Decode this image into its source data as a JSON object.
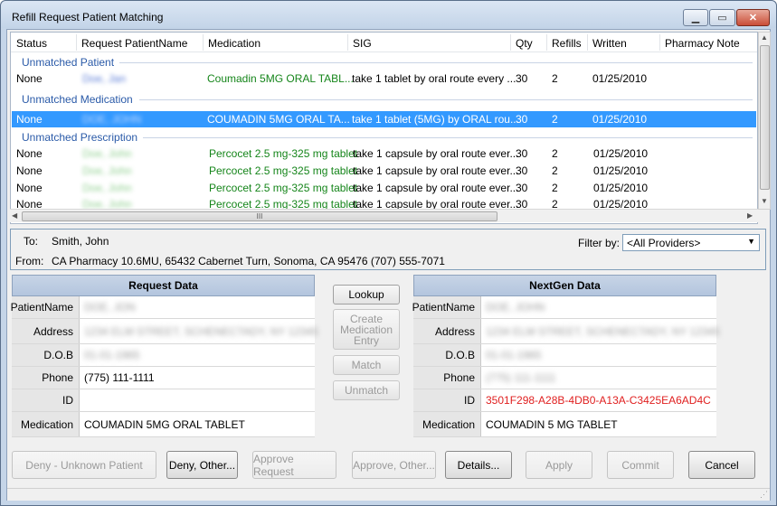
{
  "window": {
    "title": "Refill Request Patient Matching"
  },
  "list": {
    "columns": [
      "Status",
      "Request PatientName",
      "Medication",
      "SIG",
      "Qty",
      "Refills",
      "Written",
      "Pharmacy Note"
    ],
    "groups": [
      {
        "label": "Unmatched Patient"
      },
      {
        "label": "Unmatched Medication"
      },
      {
        "label": "Unmatched Prescription"
      }
    ],
    "rows": [
      {
        "status": "None",
        "name": "Doe, Jan",
        "medication": "Coumadin 5MG ORAL TABL...",
        "sig": "take 1 tablet by oral route  every ...",
        "qty": "30",
        "refills": "2",
        "written": "01/25/2010"
      },
      {
        "status": "None",
        "name": "DOE, JOHN",
        "medication": "COUMADIN 5MG ORAL TA...",
        "sig": "take 1 tablet (5MG)  by ORAL rou...",
        "qty": "30",
        "refills": "2",
        "written": "01/25/2010"
      },
      {
        "status": "None",
        "name": "Doe, John",
        "medication": "Percocet 2.5 mg-325 mg tablet",
        "sig": "take 1 capsule by oral route  ever...",
        "qty": "30",
        "refills": "2",
        "written": "01/25/2010"
      },
      {
        "status": "None",
        "name": "Doe, John",
        "medication": "Percocet 2.5 mg-325 mg tablet",
        "sig": "take 1 capsule by oral route  ever...",
        "qty": "30",
        "refills": "2",
        "written": "01/25/2010"
      },
      {
        "status": "None",
        "name": "Doe, John",
        "medication": "Percocet 2.5 mg-325 mg tablet",
        "sig": "take 1 capsule by oral route  ever...",
        "qty": "30",
        "refills": "2",
        "written": "01/25/2010"
      },
      {
        "status": "None",
        "name": "Doe, John",
        "medication": "Percocet 2.5 mg-325 mg tablet",
        "sig": "take 1 capsule by oral route  ever...",
        "qty": "30",
        "refills": "2",
        "written": "01/25/2010"
      }
    ],
    "hscroll_grip": "III"
  },
  "message": {
    "to_label": "To:",
    "to_value": "Smith, John",
    "from_label": "From:",
    "from_value": "CA Pharmacy 10.6MU, 65432 Cabernet Turn, Sonoma, CA 95476   (707) 555-7071",
    "filter_label": "Filter by:",
    "filter_value": "<All Providers>"
  },
  "request_panel": {
    "title": "Request Data",
    "labels": {
      "name": "PatientName",
      "address": "Address",
      "dob": "D.O.B",
      "phone": "Phone",
      "id": "ID",
      "medication": "Medication"
    },
    "values": {
      "name": "DOE, JON",
      "address": "1234 ELM STREET, SCHENECTADY, NY 12345",
      "dob": "01-01-1965",
      "phone": "(775) 111-1111",
      "id": "",
      "medication": "COUMADIN 5MG ORAL TABLET"
    }
  },
  "nextgen_panel": {
    "title": "NextGen Data",
    "labels": {
      "name": "PatientName",
      "address": "Address",
      "dob": "D.O.B",
      "phone": "Phone",
      "id": "ID",
      "medication": "Medication"
    },
    "values": {
      "name": "DOE, JOHN",
      "address": "1234 ELM STREET, SCHENECTADY, NY 12345",
      "dob": "01-01-1965",
      "phone": "(775) 111-1111",
      "id": "3501F298-A28B-4DB0-A13A-C3425EA6AD4C",
      "medication": "COUMADIN 5 MG TABLET"
    }
  },
  "middle_buttons": {
    "lookup": "Lookup",
    "create_line1": "Create",
    "create_line2": "Medication",
    "create_line3": "Entry",
    "match": "Match",
    "unmatch": "Unmatch"
  },
  "bottom_buttons": {
    "deny_unknown": "Deny - Unknown Patient",
    "deny_other": "Deny, Other...",
    "approve_request": "Approve Request",
    "approve_other": "Approve, Other...",
    "details": "Details...",
    "apply": "Apply",
    "commit": "Commit",
    "cancel": "Cancel"
  },
  "colors": {
    "accent_selection": "#3399ff",
    "group_header": "#2a5aa8",
    "unmatched_med": "#15851a",
    "id_value": "#e02020"
  }
}
